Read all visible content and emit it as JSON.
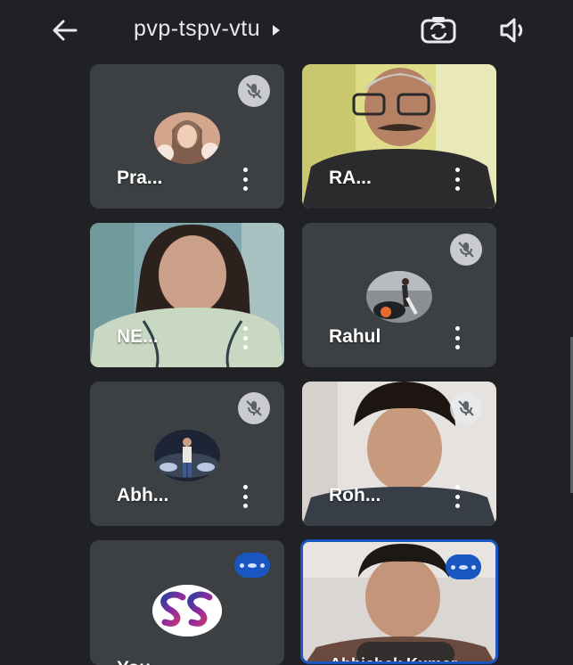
{
  "header": {
    "meeting_code": "pvp-tspv-vtu",
    "back_icon": "arrow-back-icon",
    "switch_camera_icon": "switch-camera-icon",
    "speaker_icon": "speaker-icon"
  },
  "participants": [
    {
      "name": "Pra...",
      "video": false,
      "muted": true,
      "speaking": false
    },
    {
      "name": "RA...",
      "video": true,
      "muted": false,
      "speaking": false
    },
    {
      "name": "NE...",
      "video": true,
      "muted": false,
      "speaking": false
    },
    {
      "name": "Rahul",
      "video": false,
      "muted": true,
      "speaking": false
    },
    {
      "name": "Abh...",
      "video": false,
      "muted": true,
      "speaking": false
    },
    {
      "name": "Roh...",
      "video": true,
      "muted": true,
      "speaking": false
    },
    {
      "name": "You",
      "video": false,
      "muted": false,
      "speaking": true
    },
    {
      "name": "Abhishek Kumar",
      "video": true,
      "muted": false,
      "speaking": true
    }
  ],
  "colors": {
    "background": "#202124",
    "tile": "#3c4043",
    "accent": "#1a56c2"
  }
}
